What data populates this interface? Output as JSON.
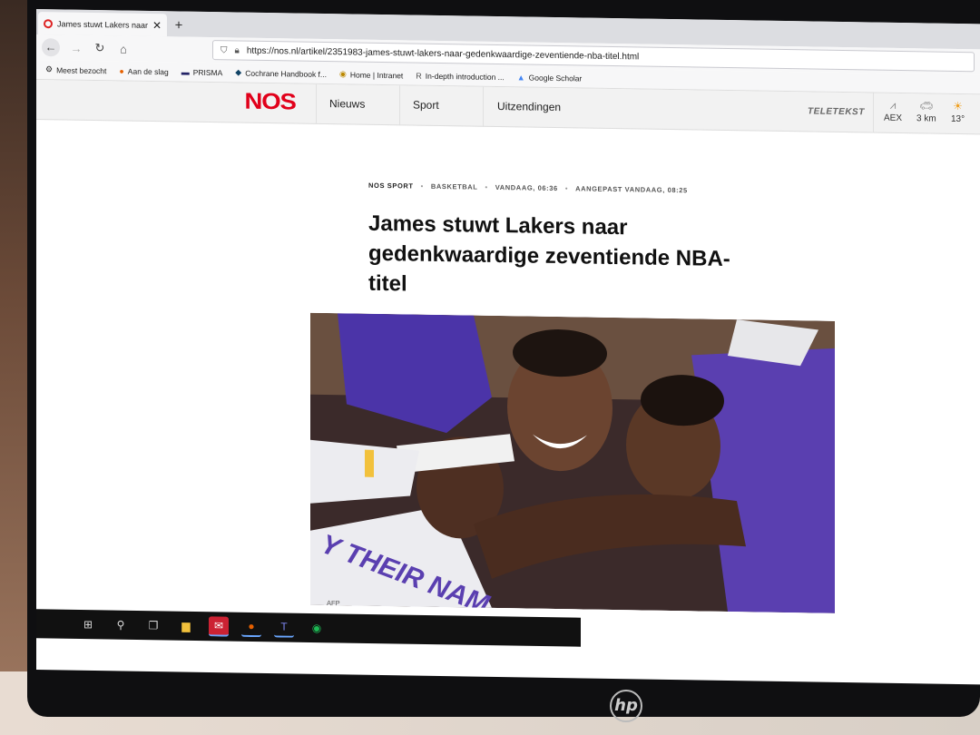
{
  "browser": {
    "tab_title": "James stuwt Lakers naar geden",
    "url": "https://nos.nl/artikel/2351983-james-stuwt-lakers-naar-gedenkwaardige-zeventiende-nba-titel.html",
    "bookmarks": [
      {
        "label": "Meest bezocht",
        "icon": "gear-icon"
      },
      {
        "label": "Aan de slag",
        "icon": "firefox-icon"
      },
      {
        "label": "PRISMA",
        "icon": "prisma-icon"
      },
      {
        "label": "Cochrane Handbook f...",
        "icon": "cochrane-icon"
      },
      {
        "label": "Home | Intranet",
        "icon": "intranet-icon"
      },
      {
        "label": "In-depth introduction ...",
        "icon": "r-icon"
      },
      {
        "label": "Google Scholar",
        "icon": "scholar-icon"
      }
    ]
  },
  "site": {
    "logo": "NOS",
    "nav": [
      "Nieuws",
      "Sport",
      "Uitzendingen"
    ],
    "teletekst": "TELETEKST",
    "widgets": [
      {
        "label": "AEX",
        "icon": "chart-icon"
      },
      {
        "label": "3 km",
        "icon": "car-icon"
      },
      {
        "label": "13°",
        "icon": "weather-icon"
      }
    ]
  },
  "article": {
    "source": "NOS SPORT",
    "category": "BASKETBAL",
    "published": "VANDAAG, 06:36",
    "updated": "AANGEPAST VANDAAG, 08:25",
    "headline": "James stuwt Lakers naar gedenkwaardige zeventiende NBA-titel",
    "photo_credit": "AFP",
    "jersey_text": "Y THEIR NAM"
  },
  "hardware": {
    "brand": "hp"
  },
  "colors": {
    "nos_red": "#e1001a",
    "lakers_purple": "#5a3fb0",
    "lakers_gold": "#f2c13c"
  }
}
